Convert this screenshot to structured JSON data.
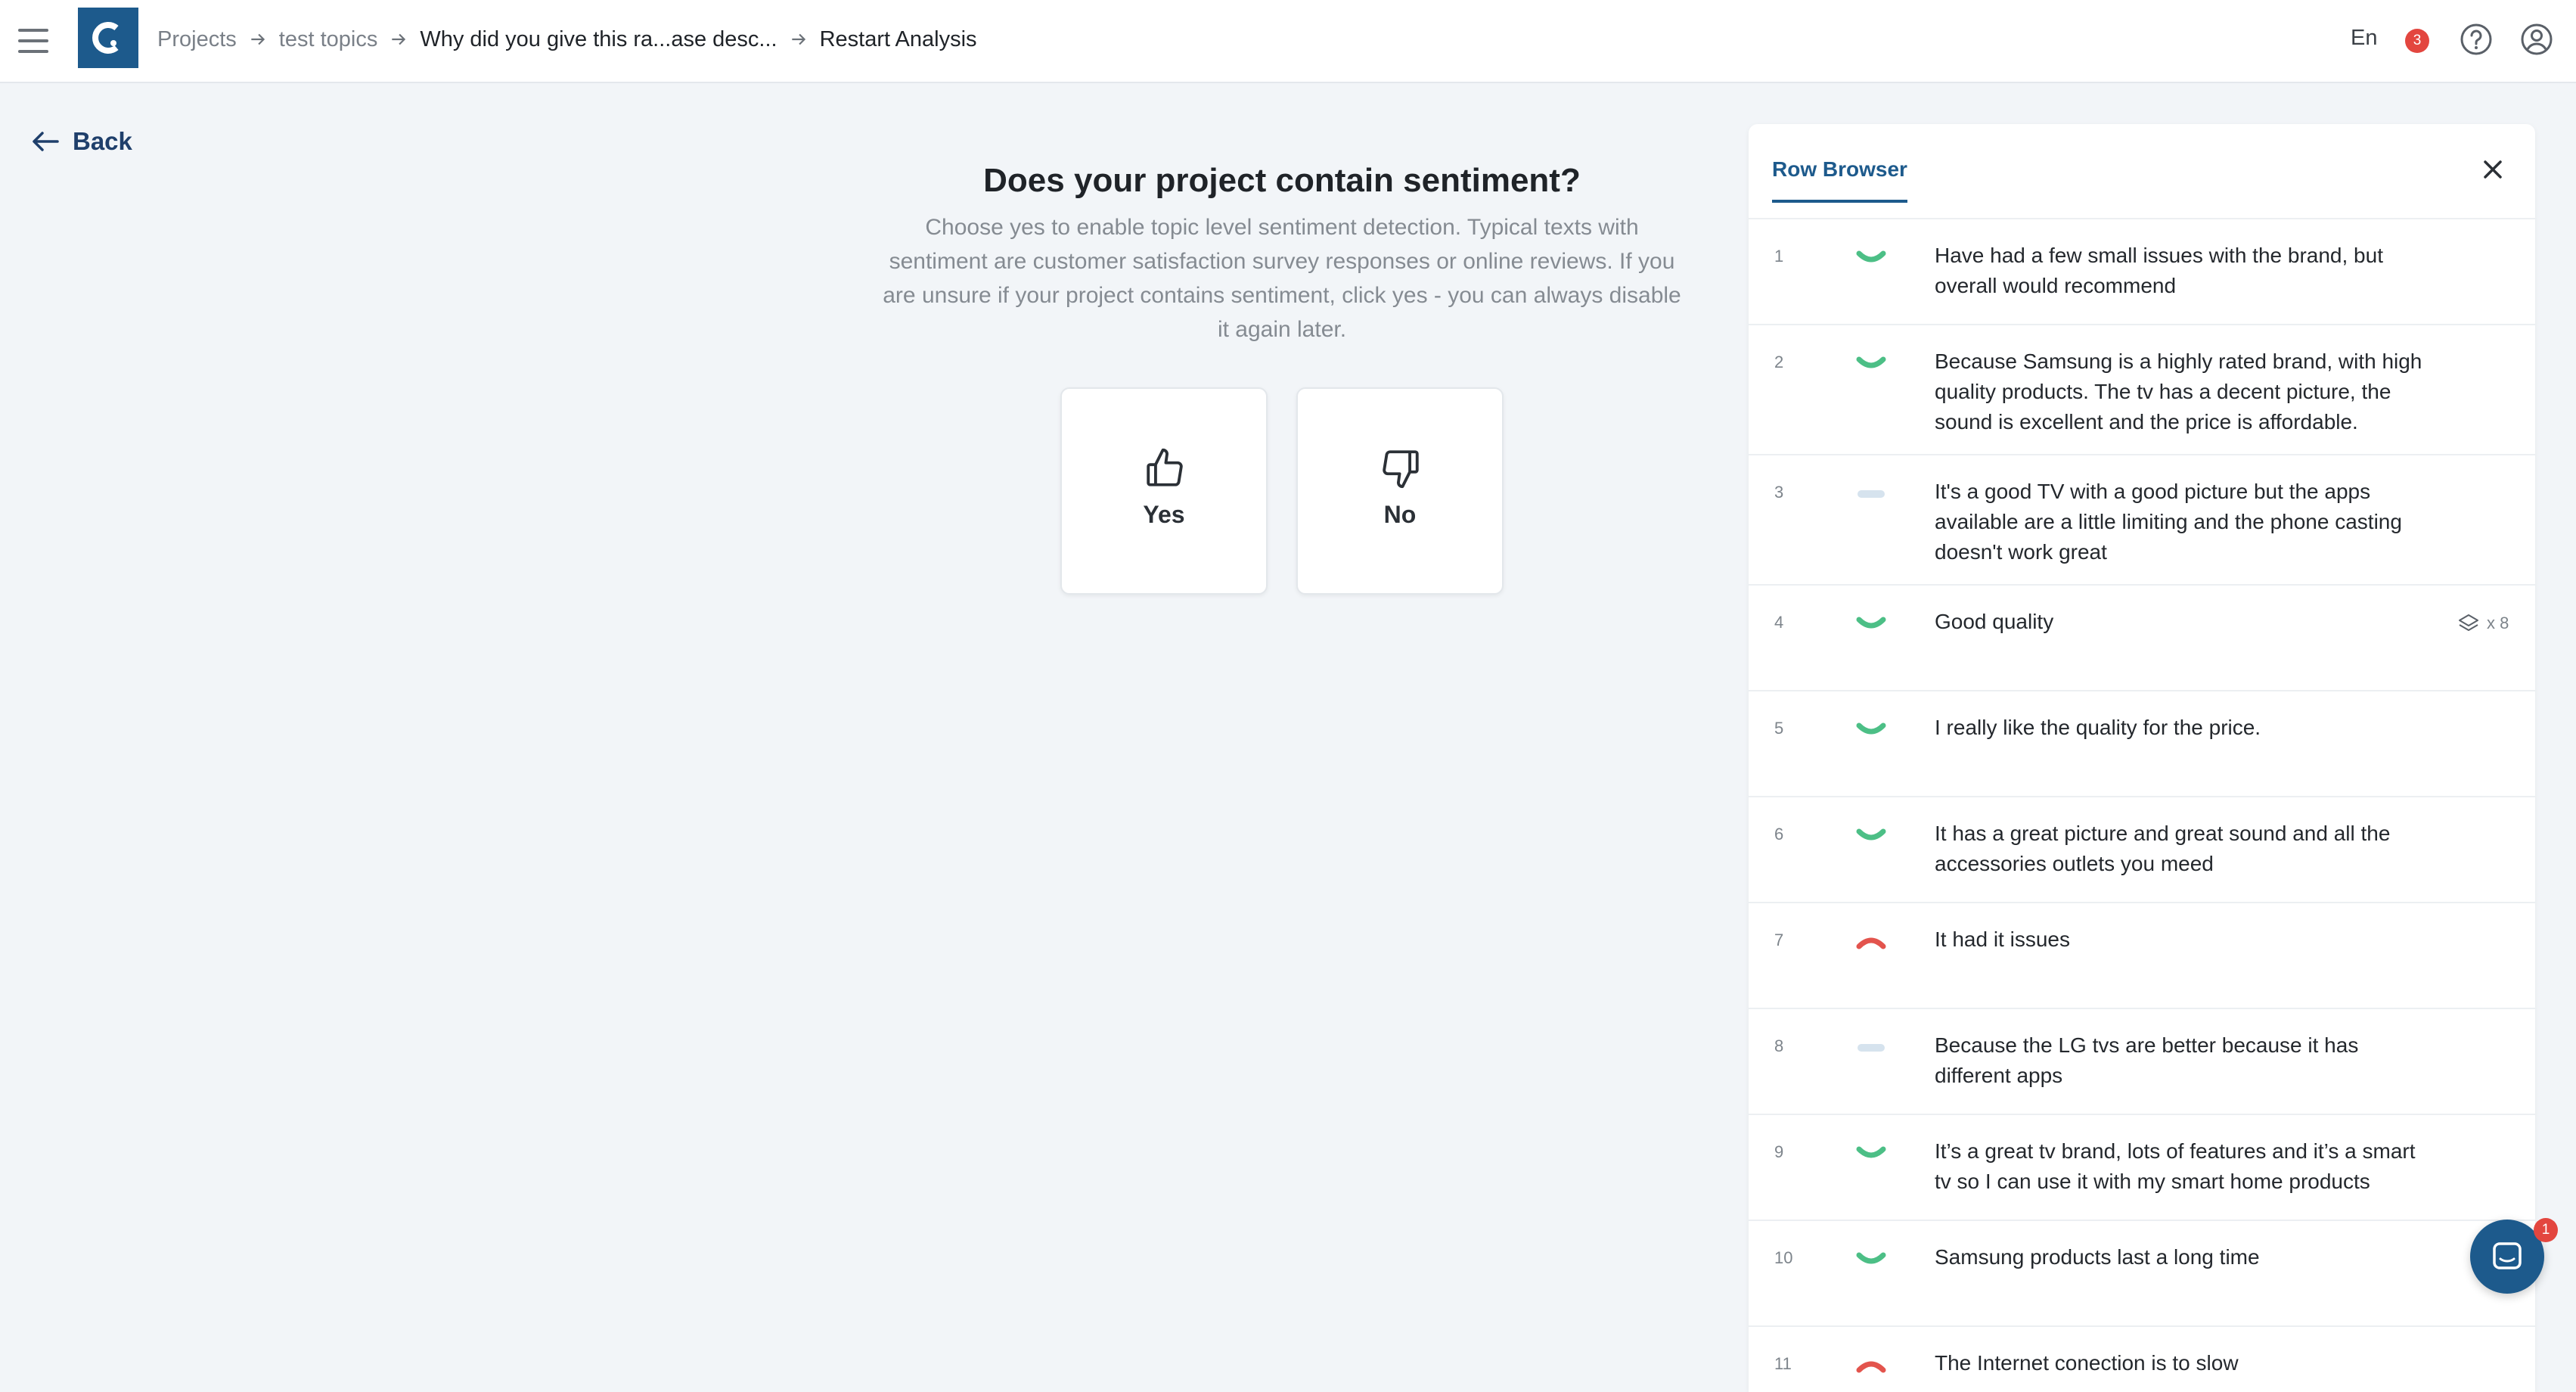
{
  "header": {
    "breadcrumb": [
      "Projects",
      "test topics",
      "Why did you give this ra...ase desc...",
      "Restart Analysis"
    ],
    "language": "En",
    "notification_count": "3"
  },
  "back_label": "Back",
  "question": {
    "title": "Does your project contain sentiment?",
    "description": "Choose yes to enable topic level sentiment detection. Typical texts with sentiment are customer satisfaction survey responses or online reviews. If you are unsure if your project contains sentiment, click yes - you can always disable it again later.",
    "yes_label": "Yes",
    "no_label": "No"
  },
  "row_browser": {
    "tab_label": "Row Browser",
    "rows": [
      {
        "num": "1",
        "sentiment": "positive",
        "text": "Have had a few small issues with the brand, but overall would recommend",
        "dup": ""
      },
      {
        "num": "2",
        "sentiment": "positive",
        "text": "Because Samsung is a highly rated brand, with high quality products. The tv has a decent picture, the sound is excellent and the price is affordable.",
        "dup": ""
      },
      {
        "num": "3",
        "sentiment": "neutral",
        "text": "It's a good TV with a good picture but the apps available are a little limiting and the phone casting doesn't work great",
        "dup": ""
      },
      {
        "num": "4",
        "sentiment": "positive",
        "text": "Good quality",
        "dup": "x 8"
      },
      {
        "num": "5",
        "sentiment": "positive",
        "text": "I really like the quality for the price.",
        "dup": ""
      },
      {
        "num": "6",
        "sentiment": "positive",
        "text": "It has a great picture and great sound and all the accessories outlets you meed",
        "dup": ""
      },
      {
        "num": "7",
        "sentiment": "negative",
        "text": "It had it issues",
        "dup": ""
      },
      {
        "num": "8",
        "sentiment": "neutral",
        "text": "Because the LG tvs are better because it has different apps",
        "dup": ""
      },
      {
        "num": "9",
        "sentiment": "positive",
        "text": "It’s a great tv brand, lots of features and it’s a smart tv so I can use it with my smart home products",
        "dup": ""
      },
      {
        "num": "10",
        "sentiment": "positive",
        "text": "Samsung products last a long time",
        "dup": ""
      },
      {
        "num": "11",
        "sentiment": "negative",
        "text": "The Internet conection is to slow",
        "dup": ""
      }
    ]
  },
  "chat_badge_count": "1",
  "colors": {
    "brand": "#1d5a8c",
    "positive": "#4cbf86",
    "negative": "#e3544d",
    "neutral": "#d6e3ee",
    "badge": "#e3463f"
  },
  "icons": {
    "menu": "hamburger-icon",
    "logo": "app-logo",
    "notifications": "notification-badge",
    "help": "help-circle-icon",
    "account": "user-circle-icon",
    "yes": "thumbs-up-icon",
    "no": "thumbs-down-icon",
    "close": "close-icon",
    "duplicates": "layers-icon",
    "chat": "chat-icon"
  }
}
